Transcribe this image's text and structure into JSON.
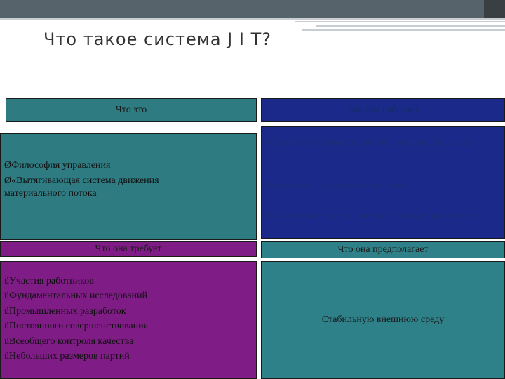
{
  "title": "Что такое система J I T?",
  "headers": {
    "what_it_is": "Что это",
    "how_it_works": "Как она работает",
    "what_it_requires": "Что она требует",
    "what_it_assumes": "Что она предполагает"
  },
  "what_it_is_items": [
    "ØФилософия управления",
    "Ø«Вытягивающая система движения материального потока"
  ],
  "how_it_works_items": [
    "ØБорьба с потерями (хранения, ожидания, брака, ...)",
    "ØВыявление проблемы и узких мест",
    "ØДобавление рациональной организации производства"
  ],
  "requires_items": [
    "üУчастия работников",
    "üФундаментальных исследований",
    "üПромышленных разработок",
    "üПостоянного совершенствования",
    "üВсеобщего контроля качества",
    "üНебольших размеров партий"
  ],
  "assumes_text": "Стабильную внешнюю среду",
  "colors": {
    "teal": "#2f7b82",
    "navy": "#1b2a8a",
    "purple": "#7f1c86"
  }
}
